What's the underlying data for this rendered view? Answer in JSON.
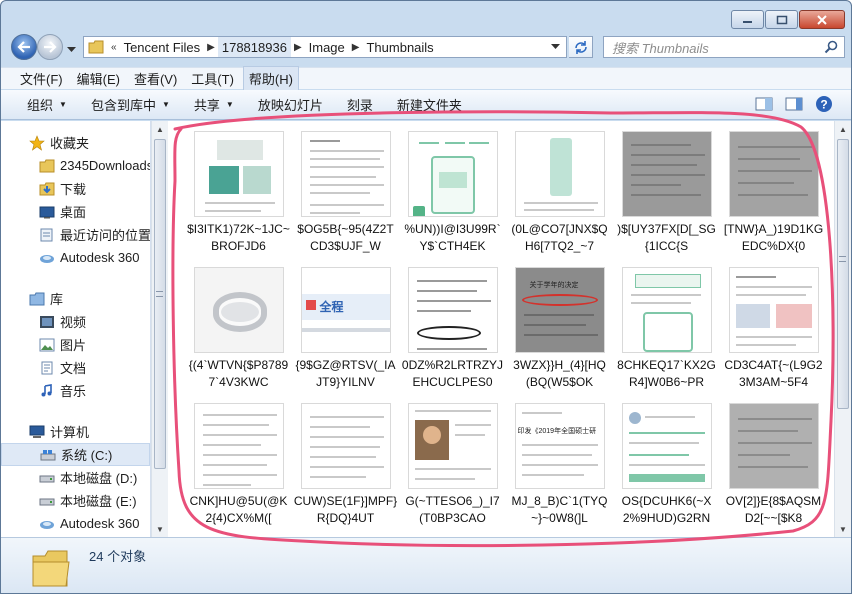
{
  "window": {
    "breadcrumbs": [
      "Tencent Files",
      "178818936",
      "Image",
      "Thumbnails"
    ],
    "search_placeholder": "搜索 Thumbnails"
  },
  "menubar": [
    "文件(F)",
    "编辑(E)",
    "查看(V)",
    "工具(T)",
    "帮助(H)"
  ],
  "toolbar": {
    "organize": "组织",
    "include_in_library": "包含到库中",
    "share": "共享",
    "slideshow": "放映幻灯片",
    "burn": "刻录",
    "new_folder": "新建文件夹"
  },
  "navpane": {
    "favorites_header": "收藏夹",
    "favorites": [
      "2345Downloads",
      "下载",
      "桌面",
      "最近访问的位置",
      "Autodesk 360"
    ],
    "libraries_header": "库",
    "libraries": [
      "视频",
      "图片",
      "文档",
      "音乐"
    ],
    "computer_header": "计算机",
    "drives": [
      "系统 (C:)",
      "本地磁盘 (D:)",
      "本地磁盘 (E:)",
      "Autodesk 360"
    ]
  },
  "files": [
    {
      "caption": "$I3ITK1)72K~1JC~BROFJD6"
    },
    {
      "caption": "$OG5B{~95(4Z2TCD3$UJF_W"
    },
    {
      "caption": "%UN))I@I3U99R`Y$`CTH4EK"
    },
    {
      "caption": "(0L@CO7[JNX$QH6[7TQ2_~7"
    },
    {
      "caption": ")$[UY37FX[D[_SG{1ICC{S"
    },
    {
      "caption": "[TNW}A_)19D1KGEDC%DX{0"
    },
    {
      "caption": "{(4`WTVN{$P87897`4V3KWC"
    },
    {
      "caption": "{9$GZ@RTSV(_IAJT9}YILNV"
    },
    {
      "caption": "0DZ%R2LRTRZYJEHCUCLPES0"
    },
    {
      "caption": "3WZX}}H_(4}[HQ(BQ(W5$OK"
    },
    {
      "caption": "8CHKEQ17`KX2GR4]W0B6~PR"
    },
    {
      "caption": "CD3C4AT{~(L9G23M3AM~5F4"
    },
    {
      "caption": "CNK]HU@5U(@K2{4)CX%M(["
    },
    {
      "caption": "CUW)SE(1F}]MPF}R{DQ}4UT"
    },
    {
      "caption": "G(~TTESO6_)_I7(T0BP3CAO"
    },
    {
      "caption": "MJ_8_B)C`1(TYQ~}~0W8(]L"
    },
    {
      "caption": "OS{DCUHK6(~X2%9HUD)G2RN"
    },
    {
      "caption": "OV[2]}E{8$AQSMD2[~~[$K8"
    }
  ],
  "thumb_text": {
    "t8_label": "全程",
    "t10_heading": "关于学年的决定",
    "t15_heading": "印发《2019年全国硕士研"
  },
  "status": {
    "count_text": "24 个对象"
  },
  "colors": {
    "annotation": "#e8507a",
    "accent": "#2f63b3"
  }
}
